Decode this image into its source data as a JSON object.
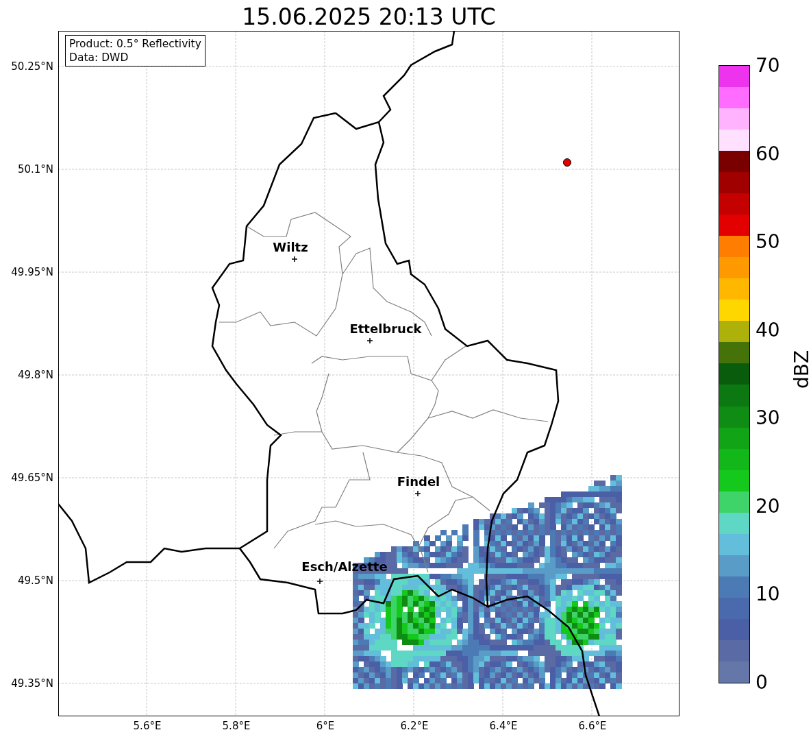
{
  "title": "15.06.2025 20:13 UTC",
  "info_box": {
    "lines": [
      "Product: 0.5° Reflectivity",
      "Data: DWD"
    ]
  },
  "x_ticks": [
    "5.6°E",
    "5.8°E",
    "6°E",
    "6.2°E",
    "6.4°E",
    "6.6°E"
  ],
  "y_ticks": [
    "50.25°N",
    "50.1°N",
    "49.95°N",
    "49.8°N",
    "49.65°N",
    "49.5°N",
    "49.35°N"
  ],
  "cities": [
    {
      "name": "Wiltz"
    },
    {
      "name": "Ettelbruck"
    },
    {
      "name": "Findel"
    },
    {
      "name": "Esch/Alzette"
    }
  ],
  "colorbar": {
    "label": "dBZ",
    "ticks": [
      "70",
      "60",
      "50",
      "40",
      "30",
      "20",
      "10",
      "0"
    ],
    "bins": [
      {
        "color": "#ee33ee"
      },
      {
        "color": "#ff6cff"
      },
      {
        "color": "#ffb3ff"
      },
      {
        "color": "#ffe1ff"
      },
      {
        "color": "#7a0000"
      },
      {
        "color": "#a00000"
      },
      {
        "color": "#c40000"
      },
      {
        "color": "#e30000"
      },
      {
        "color": "#ff7d00"
      },
      {
        "color": "#ff9900"
      },
      {
        "color": "#ffb700"
      },
      {
        "color": "#ffd700"
      },
      {
        "color": "#adb10a"
      },
      {
        "color": "#45730a"
      },
      {
        "color": "#0a5c0d"
      },
      {
        "color": "#0b7812"
      },
      {
        "color": "#0f8c14"
      },
      {
        "color": "#11a416"
      },
      {
        "color": "#12b81a"
      },
      {
        "color": "#15c81c"
      },
      {
        "color": "#3ed46a"
      },
      {
        "color": "#5ed7c4"
      },
      {
        "color": "#62bedb"
      },
      {
        "color": "#5a9cc8"
      },
      {
        "color": "#4c7ab5"
      },
      {
        "color": "#4b6aad"
      },
      {
        "color": "#4a5fa6"
      },
      {
        "color": "#5a6aa5"
      },
      {
        "color": "#6577a8"
      }
    ]
  }
}
